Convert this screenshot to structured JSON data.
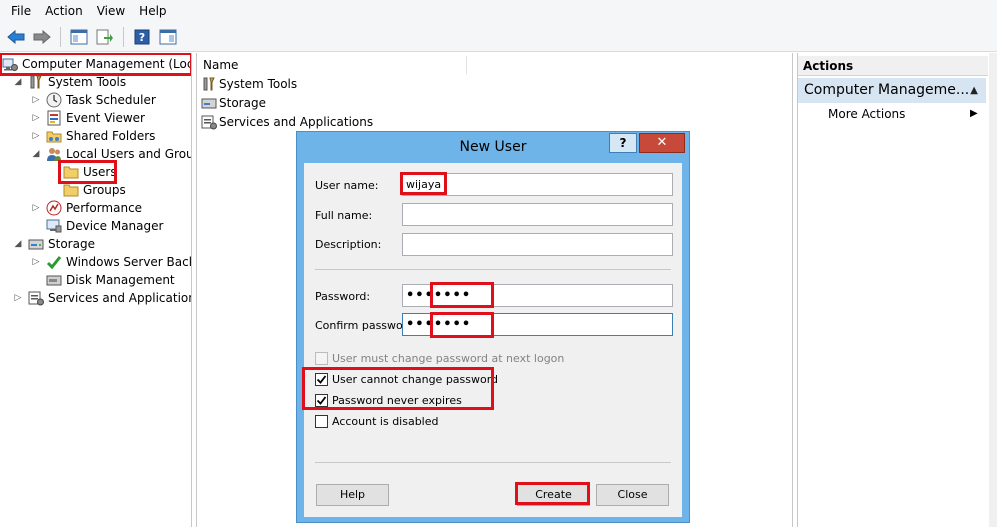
{
  "menu": [
    "File",
    "Action",
    "View",
    "Help"
  ],
  "tree": {
    "root": "Computer Management (Local",
    "system_tools": "System Tools",
    "task_scheduler": "Task Scheduler",
    "event_viewer": "Event Viewer",
    "shared_folders": "Shared Folders",
    "local_users_groups": "Local Users and Groups",
    "users": "Users",
    "groups": "Groups",
    "performance": "Performance",
    "device_manager": "Device Manager",
    "storage": "Storage",
    "windows_server_backup": "Windows Server Backup",
    "disk_management": "Disk Management",
    "services_apps": "Services and Applications"
  },
  "center": {
    "column_name": "Name",
    "items": [
      "System Tools",
      "Storage",
      "Services and Applications"
    ]
  },
  "actions": {
    "header": "Actions",
    "group": "Computer Manageme...",
    "more": "More Actions"
  },
  "dialog": {
    "title": "New User",
    "help_glyph": "?",
    "close_glyph": "✕",
    "user_name_label": "User name:",
    "user_name_value": "wijaya",
    "full_name_label": "Full name:",
    "full_name_value": "",
    "description_label": "Description:",
    "description_value": "",
    "password_label": "Password:",
    "password_value": "•••••••",
    "confirm_label": "Confirm password:",
    "confirm_value": "•••••••",
    "must_change_label": "User must change password at next logon",
    "cannot_change_label": "User cannot change password",
    "never_expires_label": "Password never expires",
    "disabled_label": "Account is disabled",
    "help_btn": "Help",
    "create_btn": "Create",
    "close_btn": "Close"
  },
  "colors": {
    "highlight": "#e0101a",
    "dialog_frame": "#6fb4e9",
    "actions_group": "#d7e4f2"
  }
}
